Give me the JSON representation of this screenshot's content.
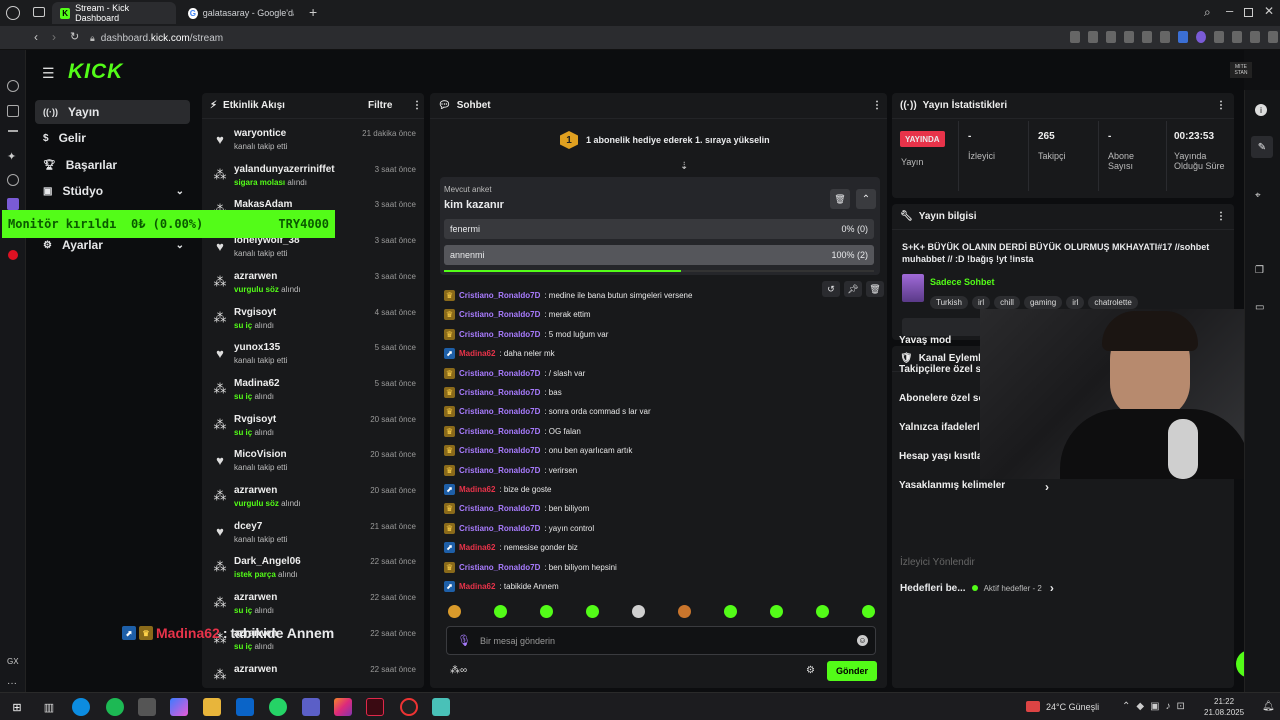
{
  "browser": {
    "tabs": [
      {
        "label": "Stream - Kick Dashboard"
      },
      {
        "label": "galatasaray - Google'da A"
      }
    ],
    "url_prefix": "dashboard.",
    "url_host": "kick.com",
    "url_path": "/stream"
  },
  "kick": {
    "logo": "KICK",
    "channel_badge": "MITE\nSTAN",
    "sidebar": [
      {
        "label": "Yayın",
        "icon": "broadcast-icon"
      },
      {
        "label": "Gelir",
        "icon": "dollar-icon"
      },
      {
        "label": "Başarılar",
        "icon": "trophy-icon"
      },
      {
        "label": "Stüdyo",
        "icon": "studio-icon"
      },
      {
        "label": "Ayarlar",
        "icon": "gear-icon"
      }
    ]
  },
  "overlay": {
    "monitor_label": "Monitör kırıldı",
    "monitor_amount": "0₺ (0.00%)",
    "monitor_goal": "TRY4000",
    "chat_user": "Madina62",
    "chat_text": "tabikide Annem"
  },
  "activity": {
    "title": "Etkinlik Akışı",
    "filter": "Filtre",
    "events": [
      {
        "name": "waryontice",
        "desc": "kanalı takip etti",
        "hl": "",
        "desc2": "",
        "time": "21 dakika önce",
        "icon": "heart"
      },
      {
        "name": "yalandunyazerriniffet",
        "desc": "",
        "hl": "sigara molası",
        "desc2": " alındı",
        "time": "3 saat önce",
        "icon": "gift"
      },
      {
        "name": "MakasAdam",
        "desc": "",
        "hl": "",
        "desc2": "",
        "time": "3 saat önce",
        "icon": "gift"
      },
      {
        "name": "lonelywolf_38",
        "desc": "kanalı takip etti",
        "hl": "",
        "desc2": "",
        "time": "3 saat önce",
        "icon": "heart"
      },
      {
        "name": "azrarwen",
        "desc": "",
        "hl": "vurgulu söz",
        "desc2": " alındı",
        "time": "3 saat önce",
        "icon": "gift"
      },
      {
        "name": "Rvgisoyt",
        "desc": "",
        "hl": "su iç",
        "desc2": " alındı",
        "time": "4 saat önce",
        "icon": "gift"
      },
      {
        "name": "yunox135",
        "desc": "kanalı takip etti",
        "hl": "",
        "desc2": "",
        "time": "5 saat önce",
        "icon": "heart"
      },
      {
        "name": "Madina62",
        "desc": "",
        "hl": "su iç",
        "desc2": " alındı",
        "time": "5 saat önce",
        "icon": "gift"
      },
      {
        "name": "Rvgisoyt",
        "desc": "",
        "hl": "su iç",
        "desc2": " alındı",
        "time": "20 saat önce",
        "icon": "gift"
      },
      {
        "name": "MicoVision",
        "desc": "kanalı takip etti",
        "hl": "",
        "desc2": "",
        "time": "20 saat önce",
        "icon": "heart"
      },
      {
        "name": "azrarwen",
        "desc": "",
        "hl": "vurgulu söz",
        "desc2": " alındı",
        "time": "20 saat önce",
        "icon": "gift"
      },
      {
        "name": "dcey7",
        "desc": "kanalı takip etti",
        "hl": "",
        "desc2": "",
        "time": "21 saat önce",
        "icon": "heart"
      },
      {
        "name": "Dark_Angel06",
        "desc": "",
        "hl": "istek parça",
        "desc2": " alındı",
        "time": "22 saat önce",
        "icon": "gift"
      },
      {
        "name": "azrarwen",
        "desc": "",
        "hl": "su iç",
        "desc2": " alındı",
        "time": "22 saat önce",
        "icon": "gift"
      },
      {
        "name": "azrarwen",
        "desc": "",
        "hl": "su iç",
        "desc2": " alındı",
        "time": "22 saat önce",
        "icon": "gift"
      },
      {
        "name": "azrarwen",
        "desc": "",
        "hl": "",
        "desc2": "",
        "time": "22 saat önce",
        "icon": "gift"
      }
    ]
  },
  "chat": {
    "title": "Sohbet",
    "banner": "1 abonelik hediye ederek 1. sıraya yükselin",
    "banner_rank": "1",
    "poll": {
      "label": "Mevcut anket",
      "question": "kim kazanır",
      "options": [
        {
          "text": "fenermi",
          "result": "0% (0)",
          "pct": 0
        },
        {
          "text": "annenmi",
          "result": "100% (2)",
          "pct": 100
        }
      ],
      "time_remaining_fraction": 0.55
    },
    "messages": [
      {
        "user": "Cristiano_Ronaldo7D",
        "text": ": medine ile bana butun simgeleri versene",
        "badge": "sub"
      },
      {
        "user": "Cristiano_Ronaldo7D",
        "text": ": merak ettim",
        "badge": "sub"
      },
      {
        "user": "Cristiano_Ronaldo7D",
        "text": ": 5 mod luğum var",
        "badge": "sub"
      },
      {
        "user": "Madina62",
        "text": ": daha neler mk",
        "badge": "blue"
      },
      {
        "user": "Cristiano_Ronaldo7D",
        "text": ": / slash var",
        "badge": "sub"
      },
      {
        "user": "Cristiano_Ronaldo7D",
        "text": ": bas",
        "badge": "sub"
      },
      {
        "user": "Cristiano_Ronaldo7D",
        "text": ": sonra orda commad s lar var",
        "badge": "sub"
      },
      {
        "user": "Cristiano_Ronaldo7D",
        "text": ": OG falan",
        "badge": "sub"
      },
      {
        "user": "Cristiano_Ronaldo7D",
        "text": ": onu ben ayarlıcam artık",
        "badge": "sub"
      },
      {
        "user": "Cristiano_Ronaldo7D",
        "text": ": verirsen",
        "badge": "sub"
      },
      {
        "user": "Madina62",
        "text": ": bize de goste",
        "badge": "blue"
      },
      {
        "user": "Cristiano_Ronaldo7D",
        "text": ": ben biliyom",
        "badge": "sub"
      },
      {
        "user": "Cristiano_Ronaldo7D",
        "text": ": yayın control",
        "badge": "sub"
      },
      {
        "user": "Madina62",
        "text": ": nemesise gonder biz",
        "badge": "blue"
      },
      {
        "user": "Cristiano_Ronaldo7D",
        "text": ": ben biliyom hepsini",
        "badge": "sub"
      },
      {
        "user": "Madina62",
        "text": ": tabikide Annem",
        "badge": "blue"
      }
    ],
    "input_placeholder": "Bir mesaj gönderin",
    "send": "Gönder"
  },
  "stats": {
    "title": "Yayın İstatistikleri",
    "live": "YAYINDA",
    "items": [
      {
        "label": "Yayın",
        "value": ""
      },
      {
        "label": "İzleyici",
        "value": "-"
      },
      {
        "label": "Takipçi",
        "value": "265"
      },
      {
        "label": "Abone Sayısı",
        "value": "-"
      },
      {
        "label": "Yayında Olduğu Süre",
        "value": "00:23:53"
      }
    ]
  },
  "info": {
    "title": "Yayın bilgisi",
    "stream_title": "S+K+ BÜYÜK OLANIN DERDİ BÜYÜK OLURMUŞ MKHAYATI#17 //sohbet muhabbet // :D !bağış !yt !insta",
    "category": "Sadece Sohbet",
    "tags": [
      "Turkish",
      "irl",
      "chill",
      "gaming",
      "irl",
      "chatrolette"
    ]
  },
  "moderation": {
    "title": "Kanal Eylemleri",
    "rows": [
      "Yavaş mod",
      "Takipçilere özel so",
      "Abonelere özel so",
      "Yalnızca ifadelerle sohbet",
      "Hesap yaşı kısıtlaması",
      "Yasaklanmış kelimeler"
    ],
    "viewer_dir": "İzleyici Yönlendir",
    "goals": "Hedefleri be...",
    "goals_sub": "Aktif hedefler - 2"
  },
  "taskbar": {
    "weather": "24°C  Güneşli",
    "time": "21:22",
    "date": "21.08.2025"
  },
  "colors": {
    "kick_green": "#53fc18",
    "live_red": "#e8334a",
    "purple": "#a97cff"
  }
}
